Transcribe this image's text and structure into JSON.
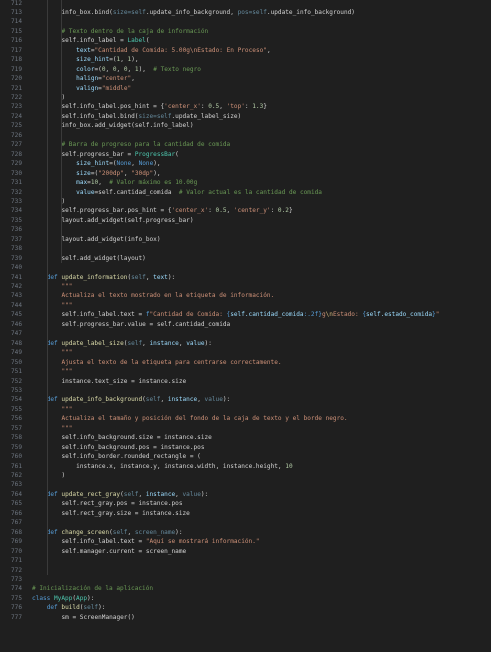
{
  "editor": {
    "first_line_number": 712,
    "lines": [
      [],
      [
        [
          8,
          "pl",
          "info_box.bind("
        ],
        [
          0,
          "self",
          "size=self"
        ],
        [
          0,
          "pl",
          ".update_info_background, "
        ],
        [
          0,
          "self",
          "pos=self"
        ],
        [
          0,
          "pl",
          ".update_info_background)"
        ]
      ],
      [],
      [
        [
          8,
          "com",
          "# Texto dentro de la caja de información"
        ]
      ],
      [
        [
          8,
          "pl",
          "self.info_label = "
        ],
        [
          0,
          "cls",
          "Label"
        ],
        [
          0,
          "pl",
          "("
        ]
      ],
      [
        [
          12,
          "var",
          "text"
        ],
        [
          0,
          "pl",
          "="
        ],
        [
          0,
          "str",
          "\"Cantidad de Comida: 5.00g\\nEstado: En Proceso\""
        ],
        [
          0,
          "pl",
          ","
        ]
      ],
      [
        [
          12,
          "var",
          "size_hint"
        ],
        [
          0,
          "pl",
          "=("
        ],
        [
          0,
          "num",
          "1"
        ],
        [
          0,
          "pl",
          ", "
        ],
        [
          0,
          "num",
          "1"
        ],
        [
          0,
          "pl",
          "),"
        ]
      ],
      [
        [
          12,
          "var",
          "color"
        ],
        [
          0,
          "pl",
          "=("
        ],
        [
          0,
          "num",
          "0"
        ],
        [
          0,
          "pl",
          ", "
        ],
        [
          0,
          "num",
          "0"
        ],
        [
          0,
          "pl",
          ", "
        ],
        [
          0,
          "num",
          "0"
        ],
        [
          0,
          "pl",
          ", "
        ],
        [
          0,
          "num",
          "1"
        ],
        [
          0,
          "pl",
          "),  "
        ],
        [
          0,
          "com",
          "# Texto negro"
        ]
      ],
      [
        [
          12,
          "var",
          "halign"
        ],
        [
          0,
          "pl",
          "="
        ],
        [
          0,
          "str",
          "\"center\""
        ],
        [
          0,
          "pl",
          ","
        ]
      ],
      [
        [
          12,
          "var",
          "valign"
        ],
        [
          0,
          "pl",
          "="
        ],
        [
          0,
          "str",
          "\"middle\""
        ]
      ],
      [
        [
          8,
          "pl",
          ")"
        ]
      ],
      [
        [
          8,
          "pl",
          "self.info_label.pos_hint = {"
        ],
        [
          0,
          "str",
          "'center_x'"
        ],
        [
          0,
          "pl",
          ": "
        ],
        [
          0,
          "num",
          "0.5"
        ],
        [
          0,
          "pl",
          ", "
        ],
        [
          0,
          "str",
          "'top'"
        ],
        [
          0,
          "pl",
          ": "
        ],
        [
          0,
          "num",
          "1.3"
        ],
        [
          0,
          "pl",
          "}"
        ]
      ],
      [
        [
          8,
          "pl",
          "self.info_label.bind("
        ],
        [
          0,
          "self",
          "size=self"
        ],
        [
          0,
          "pl",
          ".update_label_size)"
        ]
      ],
      [
        [
          8,
          "pl",
          "info_box.add_widget(self.info_label)"
        ]
      ],
      [],
      [
        [
          8,
          "com",
          "# Barra de progreso para la cantidad de comida"
        ]
      ],
      [
        [
          8,
          "pl",
          "self.progress_bar = "
        ],
        [
          0,
          "cls",
          "ProgressBar"
        ],
        [
          0,
          "pl",
          "("
        ]
      ],
      [
        [
          12,
          "var",
          "size_hint"
        ],
        [
          0,
          "pl",
          "=("
        ],
        [
          0,
          "kw",
          "None"
        ],
        [
          0,
          "pl",
          ", "
        ],
        [
          0,
          "kw",
          "None"
        ],
        [
          0,
          "pl",
          "),"
        ]
      ],
      [
        [
          12,
          "var",
          "size"
        ],
        [
          0,
          "pl",
          "=("
        ],
        [
          0,
          "str",
          "\"200dp\""
        ],
        [
          0,
          "pl",
          ", "
        ],
        [
          0,
          "str",
          "\"30dp\""
        ],
        [
          0,
          "pl",
          "),"
        ]
      ],
      [
        [
          12,
          "var",
          "max"
        ],
        [
          0,
          "pl",
          "="
        ],
        [
          0,
          "num",
          "10"
        ],
        [
          0,
          "pl",
          ",  "
        ],
        [
          0,
          "com",
          "# Valor máximo es 10.00g"
        ]
      ],
      [
        [
          12,
          "var",
          "value"
        ],
        [
          0,
          "pl",
          "=self.cantidad_comida  "
        ],
        [
          0,
          "com",
          "# Valor actual es la cantidad de comida"
        ]
      ],
      [
        [
          8,
          "pl",
          ")"
        ]
      ],
      [
        [
          8,
          "pl",
          "self.progress_bar.pos_hint = {"
        ],
        [
          0,
          "str",
          "'center_x'"
        ],
        [
          0,
          "pl",
          ": "
        ],
        [
          0,
          "num",
          "0.5"
        ],
        [
          0,
          "pl",
          ", "
        ],
        [
          0,
          "str",
          "'center_y'"
        ],
        [
          0,
          "pl",
          ": "
        ],
        [
          0,
          "num",
          "0.2"
        ],
        [
          0,
          "pl",
          "}"
        ]
      ],
      [
        [
          8,
          "pl",
          "layout.add_widget(self.progress_bar)"
        ]
      ],
      [],
      [
        [
          8,
          "pl",
          "layout.add_widget(info_box)"
        ]
      ],
      [],
      [
        [
          8,
          "pl",
          "self.add_widget(layout)"
        ]
      ],
      [],
      [
        [
          4,
          "kw",
          "def "
        ],
        [
          0,
          "fn",
          "update_information"
        ],
        [
          0,
          "pl",
          "("
        ],
        [
          0,
          "self",
          "self"
        ],
        [
          0,
          "pl",
          ", "
        ],
        [
          0,
          "var",
          "text"
        ],
        [
          0,
          "pl",
          "):"
        ]
      ],
      [
        [
          8,
          "str",
          "\"\"\""
        ]
      ],
      [
        [
          8,
          "str",
          "Actualiza el texto mostrado en la etiqueta de información."
        ]
      ],
      [
        [
          8,
          "str",
          "\"\"\""
        ]
      ],
      [
        [
          8,
          "pl",
          "self.info_label.text = "
        ],
        [
          0,
          "kw",
          "f"
        ],
        [
          0,
          "str",
          "\"Cantidad de Comida: "
        ],
        [
          0,
          "kw",
          "{"
        ],
        [
          0,
          "var",
          "self.cantidad_comida"
        ],
        [
          0,
          "kw",
          ":.2f"
        ],
        [
          0,
          "kw",
          "}"
        ],
        [
          0,
          "str",
          "g"
        ],
        [
          0,
          "esc",
          "\\n"
        ],
        [
          0,
          "str",
          "Estado: "
        ],
        [
          0,
          "kw",
          "{"
        ],
        [
          0,
          "var",
          "self.estado_comida"
        ],
        [
          0,
          "kw",
          "}"
        ],
        [
          0,
          "str",
          "\""
        ]
      ],
      [
        [
          8,
          "pl",
          "self.progress_bar.value = self.cantidad_comida"
        ]
      ],
      [],
      [
        [
          4,
          "kw",
          "def "
        ],
        [
          0,
          "fn",
          "update_label_size"
        ],
        [
          0,
          "pl",
          "("
        ],
        [
          0,
          "self",
          "self"
        ],
        [
          0,
          "pl",
          ", "
        ],
        [
          0,
          "var",
          "instance"
        ],
        [
          0,
          "pl",
          ", "
        ],
        [
          0,
          "var",
          "value"
        ],
        [
          0,
          "pl",
          "):"
        ]
      ],
      [
        [
          8,
          "str",
          "\"\"\""
        ]
      ],
      [
        [
          8,
          "str",
          "Ajusta el texto de la etiqueta para centrarse correctamente."
        ]
      ],
      [
        [
          8,
          "str",
          "\"\"\""
        ]
      ],
      [
        [
          8,
          "pl",
          "instance.text_size = instance.size"
        ]
      ],
      [],
      [
        [
          4,
          "kw",
          "def "
        ],
        [
          0,
          "fn",
          "update_info_background"
        ],
        [
          0,
          "pl",
          "("
        ],
        [
          0,
          "self",
          "self"
        ],
        [
          0,
          "pl",
          ", "
        ],
        [
          0,
          "var",
          "instance"
        ],
        [
          0,
          "pl",
          ", "
        ],
        [
          0,
          "self",
          "value"
        ],
        [
          0,
          "pl",
          "):"
        ]
      ],
      [
        [
          8,
          "str",
          "\"\"\""
        ]
      ],
      [
        [
          8,
          "str",
          "Actualiza el tamaño y posición del fondo de la caja de texto y el borde negro."
        ]
      ],
      [
        [
          8,
          "str",
          "\"\"\""
        ]
      ],
      [
        [
          8,
          "pl",
          "self.info_background.size = instance.size"
        ]
      ],
      [
        [
          8,
          "pl",
          "self.info_background.pos = instance.pos"
        ]
      ],
      [
        [
          8,
          "pl",
          "self.info_border.rounded_rectangle = ("
        ]
      ],
      [
        [
          12,
          "pl",
          "instance.x, instance.y, instance.width, instance.height, "
        ],
        [
          0,
          "num",
          "10"
        ]
      ],
      [
        [
          8,
          "pl",
          ")"
        ]
      ],
      [],
      [
        [
          4,
          "kw",
          "def "
        ],
        [
          0,
          "fn",
          "update_rect_gray"
        ],
        [
          0,
          "pl",
          "("
        ],
        [
          0,
          "self",
          "self"
        ],
        [
          0,
          "pl",
          ", "
        ],
        [
          0,
          "var",
          "instance"
        ],
        [
          0,
          "pl",
          ", "
        ],
        [
          0,
          "self",
          "value"
        ],
        [
          0,
          "pl",
          "):"
        ]
      ],
      [
        [
          8,
          "pl",
          "self.rect_gray.pos = instance.pos"
        ]
      ],
      [
        [
          8,
          "pl",
          "self.rect_gray.size = instance.size"
        ]
      ],
      [],
      [
        [
          4,
          "kw",
          "def "
        ],
        [
          0,
          "fn",
          "change_screen"
        ],
        [
          0,
          "pl",
          "("
        ],
        [
          0,
          "self",
          "self"
        ],
        [
          0,
          "pl",
          ", "
        ],
        [
          0,
          "self",
          "screen_name"
        ],
        [
          0,
          "pl",
          "):"
        ]
      ],
      [
        [
          8,
          "pl",
          "self.info_label.text = "
        ],
        [
          0,
          "str",
          "\"Aquí se mostrará información.\""
        ]
      ],
      [
        [
          8,
          "pl",
          "self.manager.current = screen_name"
        ]
      ],
      [],
      [],
      [],
      [
        [
          0,
          "com",
          "# Inicialización de la aplicación"
        ]
      ],
      [
        [
          0,
          "kw",
          "class "
        ],
        [
          0,
          "cls",
          "MyApp"
        ],
        [
          0,
          "pl",
          "("
        ],
        [
          0,
          "cls",
          "App"
        ],
        [
          0,
          "pl",
          "):"
        ]
      ],
      [
        [
          4,
          "kw",
          "def "
        ],
        [
          0,
          "fn",
          "build"
        ],
        [
          0,
          "pl",
          "("
        ],
        [
          0,
          "self",
          "self"
        ],
        [
          0,
          "pl",
          "):"
        ]
      ],
      [
        [
          8,
          "pl",
          "sm = ScreenManager()"
        ]
      ]
    ]
  }
}
